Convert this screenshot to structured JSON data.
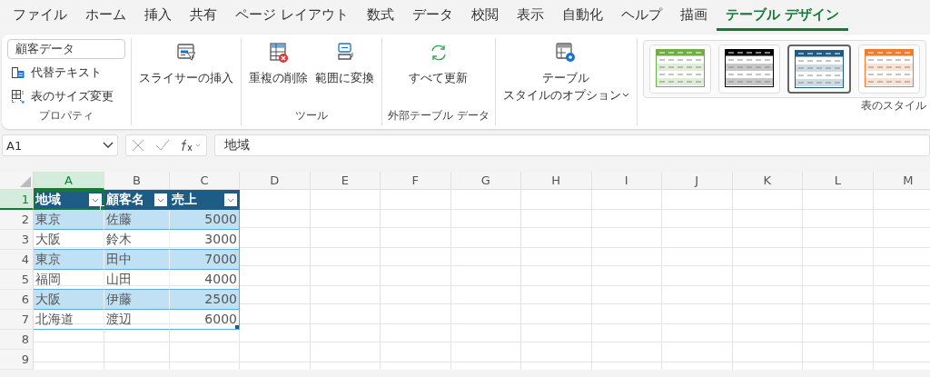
{
  "tabs": [
    {
      "label": "ファイル",
      "selected": false
    },
    {
      "label": "ホーム",
      "selected": false
    },
    {
      "label": "挿入",
      "selected": false
    },
    {
      "label": "共有",
      "selected": false
    },
    {
      "label": "ページ レイアウト",
      "selected": false
    },
    {
      "label": "数式",
      "selected": false
    },
    {
      "label": "データ",
      "selected": false
    },
    {
      "label": "校閲",
      "selected": false
    },
    {
      "label": "表示",
      "selected": false
    },
    {
      "label": "自動化",
      "selected": false
    },
    {
      "label": "ヘルプ",
      "selected": false
    },
    {
      "label": "描画",
      "selected": false
    },
    {
      "label": "テーブル デザイン",
      "selected": true
    }
  ],
  "ribbon": {
    "properties": {
      "table_name": "顧客データ",
      "items": [
        {
          "kind": "alt-text",
          "label": "代替テキスト"
        },
        {
          "kind": "resize",
          "label": "表のサイズ変更"
        }
      ],
      "label": "プロパティ"
    },
    "groups": [
      {
        "items": [
          {
            "kind": "slicer",
            "lines": [
              "スライサーの挿入"
            ]
          }
        ]
      },
      {
        "label": "ツール",
        "items": [
          {
            "kind": "remove-duplicates",
            "lines": [
              "重複の削除"
            ]
          },
          {
            "kind": "convert-range",
            "lines": [
              "範囲に変換"
            ]
          }
        ]
      },
      {
        "label": "外部テーブル データ",
        "items": [
          {
            "kind": "refresh",
            "lines": [
              "すべて更新"
            ]
          }
        ]
      },
      {
        "items": [
          {
            "kind": "style-options",
            "lines": [
              "テーブル",
              "スタイルのオプション"
            ],
            "dropdown": true
          }
        ]
      }
    ],
    "styles": {
      "label": "表のスタイル",
      "items": [
        {
          "color": "#70ad47",
          "selected": false
        },
        {
          "color": "#000000",
          "selected": false
        },
        {
          "color": "#1f5c85",
          "selected": true
        },
        {
          "color": "#ed7d31",
          "selected": false
        }
      ]
    }
  },
  "formula_bar": {
    "name_box": "A1",
    "formula": "地域"
  },
  "sheet": {
    "columns": [
      {
        "label": "A",
        "selected": true
      },
      {
        "label": "B",
        "selected": false
      },
      {
        "label": "C",
        "selected": false
      },
      {
        "label": "D",
        "selected": false
      },
      {
        "label": "E",
        "selected": false
      },
      {
        "label": "F",
        "selected": false
      },
      {
        "label": "G",
        "selected": false
      },
      {
        "label": "H",
        "selected": false
      },
      {
        "label": "I",
        "selected": false
      },
      {
        "label": "J",
        "selected": false
      },
      {
        "label": "K",
        "selected": false
      },
      {
        "label": "L",
        "selected": false
      },
      {
        "label": "M",
        "selected": false
      }
    ],
    "rows": [
      {
        "label": "1",
        "selected": true
      },
      {
        "label": "2",
        "selected": false
      },
      {
        "label": "3",
        "selected": false
      },
      {
        "label": "4",
        "selected": false
      },
      {
        "label": "5",
        "selected": false
      },
      {
        "label": "6",
        "selected": false
      },
      {
        "label": "7",
        "selected": false
      },
      {
        "label": "8",
        "selected": false
      },
      {
        "label": "9",
        "selected": false
      }
    ],
    "table": {
      "header": [
        "地域",
        "顧客名",
        "売上"
      ],
      "rows": [
        [
          "東京",
          "佐藤",
          "5000"
        ],
        [
          "大阪",
          "鈴木",
          "3000"
        ],
        [
          "東京",
          "田中",
          "7000"
        ],
        [
          "福岡",
          "山田",
          "4000"
        ],
        [
          "大阪",
          "伊藤",
          "2500"
        ],
        [
          "北海道",
          "渡辺",
          "6000"
        ]
      ]
    }
  }
}
